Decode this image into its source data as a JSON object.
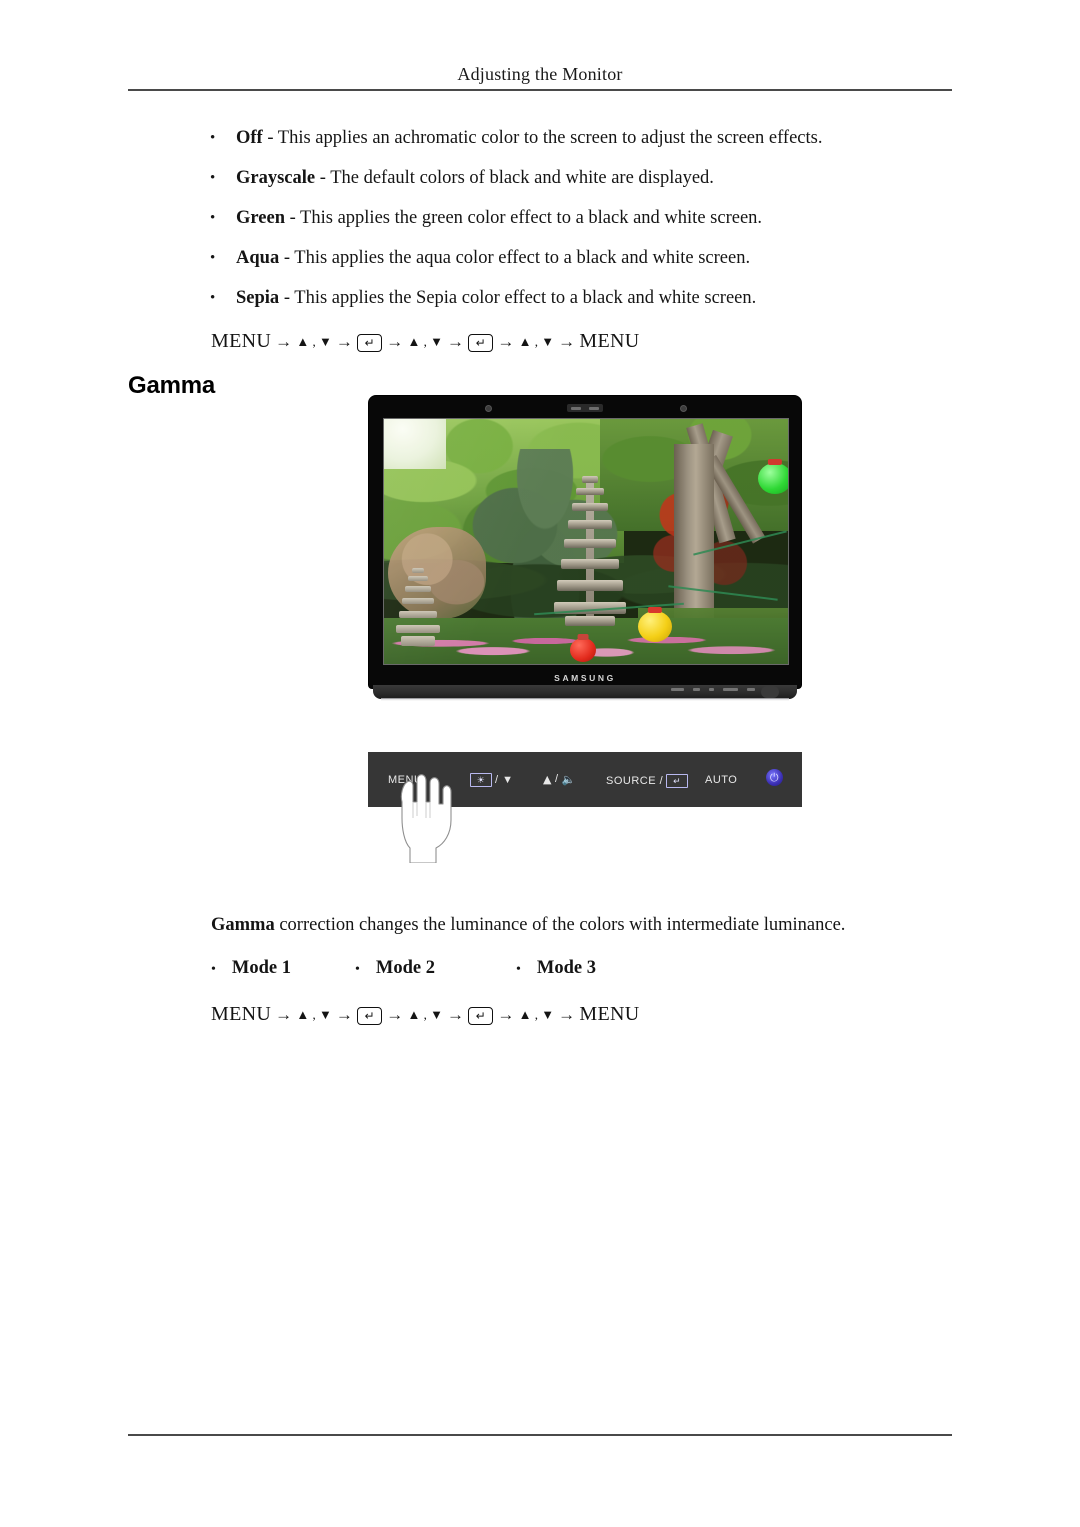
{
  "header": {
    "title": "Adjusting the Monitor"
  },
  "color_effect_list": [
    {
      "term": "Off",
      "desc": " - This applies an achromatic color to the screen to adjust the screen effects."
    },
    {
      "term": "Grayscale",
      "desc": " - The default colors of black and white are displayed."
    },
    {
      "term": "Green",
      "desc": " - This applies the green color effect to a black and white screen."
    },
    {
      "term": "Aqua",
      "desc": " - This applies the aqua color effect to a black and white screen."
    },
    {
      "term": "Sepia",
      "desc": " - This applies the Sepia color effect to a black and white screen."
    }
  ],
  "menu_path": {
    "start": "MENU",
    "updown": "▲ , ▼",
    "arrow": "→",
    "enter_key": "↵",
    "end": "MENU",
    "full_text": "MENU → ▲ , ▼ → ↵ → ▲ , ▼ → ↵ → ▲ , ▼ → MENU"
  },
  "section": {
    "heading": "Gamma",
    "description_bold": "Gamma",
    "description_rest": " correction changes the luminance of the colors with intermediate luminance."
  },
  "modes": [
    {
      "label": "Mode 1"
    },
    {
      "label": "Mode 2"
    },
    {
      "label": "Mode 3"
    }
  ],
  "monitor": {
    "brand": "SAMSUNG",
    "screen_alt": "Garden scene with stone pagoda, trees and colored lanterns"
  },
  "control_panel": {
    "menu_label": "MENU",
    "brightness_label": "/ ▼",
    "brightness_key": "☀",
    "volume_up": "▲",
    "volume_label": "/",
    "volume_key": "ὐa",
    "source_label": "SOURCE /",
    "source_key": "↵",
    "auto_label": "AUTO",
    "power_glyph": "⏻"
  },
  "bullet_char": "•",
  "colors": {
    "rule": "#4a4a4a",
    "text": "#151515",
    "panel_bg": "#363636",
    "power_accent": "#3b2fb4"
  }
}
